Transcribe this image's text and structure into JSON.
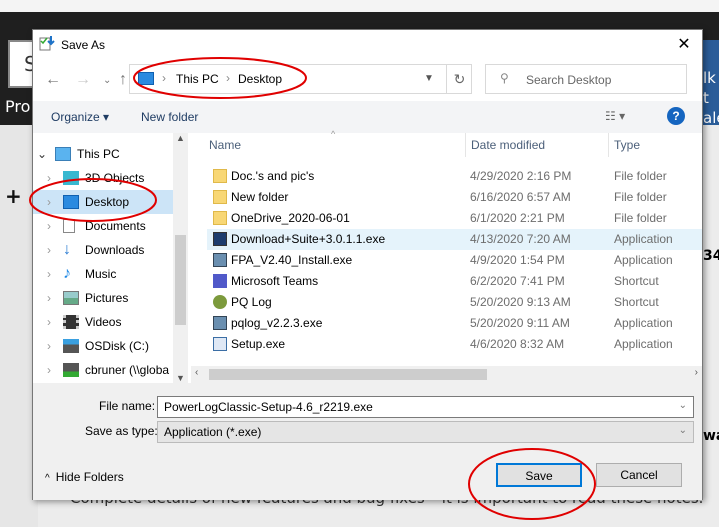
{
  "background": {
    "left_box_letter": "S",
    "left_text": "Pro",
    "right_lines": [
      "lk t",
      "ale"
    ],
    "right_num": "34",
    "right_bold": "war",
    "plus": "+",
    "bottom_text": "Complete details of new features and bug fixes – it is important to read these notes."
  },
  "dialog": {
    "title": "Save As",
    "close": "✕",
    "address": {
      "crumbs": [
        "This PC",
        "Desktop"
      ],
      "separator": "›"
    },
    "search_placeholder": "Search Desktop",
    "toolbar": {
      "organize": "Organize ▾",
      "new_folder": "New folder",
      "view": "☷ ▾",
      "help": "?"
    },
    "nav": [
      {
        "label": "This PC",
        "icon": "pc-icon",
        "expanded": true
      },
      {
        "label": "3D Objects",
        "icon": "cube-icon"
      },
      {
        "label": "Desktop",
        "icon": "desktop-icon",
        "selected": true
      },
      {
        "label": "Documents",
        "icon": "document-icon"
      },
      {
        "label": "Downloads",
        "icon": "download-icon"
      },
      {
        "label": "Music",
        "icon": "music-icon"
      },
      {
        "label": "Pictures",
        "icon": "pictures-icon"
      },
      {
        "label": "Videos",
        "icon": "videos-icon"
      },
      {
        "label": "OSDisk (C:)",
        "icon": "disk-icon"
      },
      {
        "label": "cbruner (\\\\globa",
        "icon": "network-drive-icon"
      }
    ],
    "columns": {
      "name": "Name",
      "date": "Date modified",
      "type": "Type"
    },
    "files": [
      {
        "name": "Doc.'s and pic's",
        "date": "4/29/2020 2:16 PM",
        "type": "File folder",
        "icon": "folder-icon"
      },
      {
        "name": "New folder",
        "date": "6/16/2020 6:57 AM",
        "type": "File folder",
        "icon": "folder-icon"
      },
      {
        "name": "OneDrive_2020-06-01",
        "date": "6/1/2020 2:21 PM",
        "type": "File folder",
        "icon": "folder-icon"
      },
      {
        "name": "Download+Suite+3.0.1.1.exe",
        "date": "4/13/2020 7:20 AM",
        "type": "Application",
        "icon": "app-icon",
        "hover": true
      },
      {
        "name": "FPA_V2.40_Install.exe",
        "date": "4/9/2020 1:54 PM",
        "type": "Application",
        "icon": "installer-icon"
      },
      {
        "name": "Microsoft Teams",
        "date": "6/2/2020 7:41 PM",
        "type": "Shortcut",
        "icon": "teams-icon"
      },
      {
        "name": "PQ Log",
        "date": "5/20/2020 9:13 AM",
        "type": "Shortcut",
        "icon": "shortcut-icon"
      },
      {
        "name": "pqlog_v2.2.3.exe",
        "date": "5/20/2020 9:11 AM",
        "type": "Application",
        "icon": "installer-icon"
      },
      {
        "name": "Setup.exe",
        "date": "4/6/2020 8:32 AM",
        "type": "Application",
        "icon": "setup-icon"
      }
    ],
    "file_name_label": "File name:",
    "file_name": "PowerLogClassic-Setup-4.6_r2219.exe",
    "save_type_label": "Save as type:",
    "save_type": "Application (*.exe)",
    "hide_folders": "Hide Folders",
    "save": "Save",
    "cancel": "Cancel"
  },
  "colors": {
    "selection": "#cce4f7",
    "hover": "#e5f3fb",
    "annotation": "#e00000",
    "default_button_border": "#0078d7"
  }
}
